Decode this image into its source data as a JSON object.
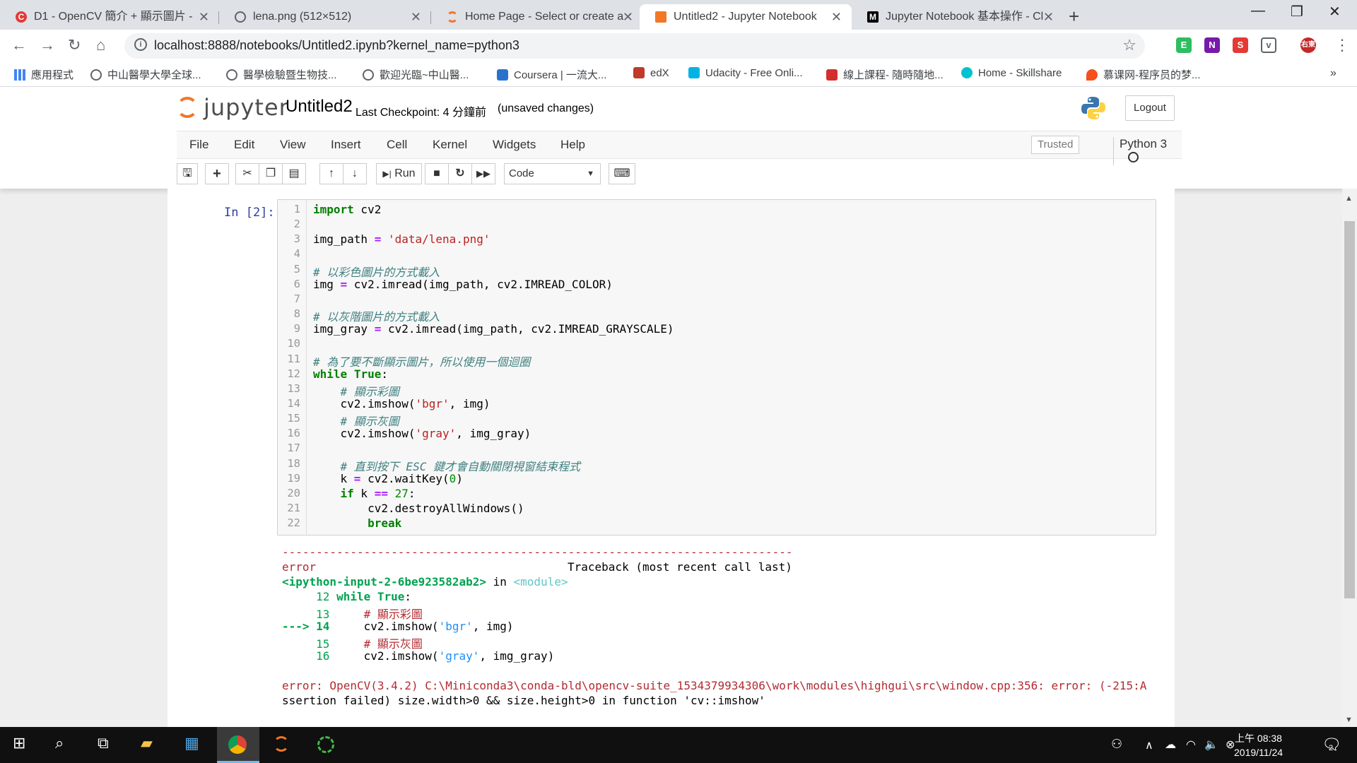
{
  "browser": {
    "tabs": [
      {
        "title": "D1 - OpenCV 簡介 + 顯示圖片 - ",
        "favicon": "red-c-icon",
        "active": false
      },
      {
        "title": "lena.png (512×512)",
        "favicon": "globe-icon",
        "active": false
      },
      {
        "title": "Home Page - Select or create a",
        "favicon": "jupyter-icon",
        "active": false
      },
      {
        "title": "Untitled2 - Jupyter Notebook",
        "favicon": "notebook-icon",
        "active": true
      },
      {
        "title": "Jupyter Notebook 基本操作 - Cl",
        "favicon": "medium-icon",
        "active": false
      }
    ],
    "url": "localhost:8888/notebooks/Untitled2.ipynb?kernel_name=python3",
    "profile": "右東",
    "bookmarks": [
      "應用程式",
      "中山醫學大學全球...",
      "醫學檢驗暨生物技...",
      "歡迎光臨~中山醫...",
      "Coursera | 一流大...",
      "edX",
      "Udacity - Free Onli...",
      "線上課程- 隨時隨地...",
      "Home - Skillshare",
      "慕课网-程序员的梦..."
    ]
  },
  "jupyter": {
    "logo_text": "jupyter",
    "notebook_name": "Untitled2",
    "checkpoint": "Last Checkpoint: 4 分鐘前",
    "unsaved": "(unsaved changes)",
    "logout": "Logout",
    "menu": [
      "File",
      "Edit",
      "View",
      "Insert",
      "Cell",
      "Kernel",
      "Widgets",
      "Help"
    ],
    "trusted": "Trusted",
    "kernel": "Python 3",
    "run_label": "Run",
    "cell_type": "Code"
  },
  "cell": {
    "prompt": "In [2]:",
    "line_numbers": [
      "1",
      "2",
      "3",
      "4",
      "5",
      "6",
      "7",
      "8",
      "9",
      "10",
      "11",
      "12",
      "13",
      "14",
      "15",
      "16",
      "17",
      "18",
      "19",
      "20",
      "21",
      "22"
    ],
    "code": [
      "import cv2",
      "",
      "img_path = 'data/lena.png'",
      "",
      "# 以彩色圖片的方式載入",
      "img = cv2.imread(img_path, cv2.IMREAD_COLOR)",
      "",
      "# 以灰階圖片的方式載入",
      "img_gray = cv2.imread(img_path, cv2.IMREAD_GRAYSCALE)",
      "",
      "# 為了要不斷顯示圖片，所以使用一個迴圈",
      "while True:",
      "    # 顯示彩圖",
      "    cv2.imshow('bgr', img)",
      "    # 顯示灰圖",
      "    cv2.imshow('gray', img_gray)",
      "",
      "    # 直到按下 ESC 鍵才會自動關閉視窗結束程式",
      "    k = cv2.waitKey(0)",
      "    if k == 27:",
      "        cv2.destroyAllWindows()",
      "        break"
    ]
  },
  "output": {
    "dashes": "---------------------------------------------------------------------------",
    "error_name": "error",
    "traceback_label": "Traceback (most recent call last)",
    "input_ref": "<ipython-input-2-6be923582ab2>",
    "in_word": " in ",
    "module": "<module>",
    "tb_lines": [
      {
        "marker": "     ",
        "num": "12",
        "code": " while True:"
      },
      {
        "marker": "     ",
        "num": "13",
        "code": "     # 顯示彩圖"
      },
      {
        "marker": "---> ",
        "num": "14",
        "code": "     cv2.imshow('bgr', img)"
      },
      {
        "marker": "     ",
        "num": "15",
        "code": "     # 顯示灰圖"
      },
      {
        "marker": "     ",
        "num": "16",
        "code": "     cv2.imshow('gray', img_gray)"
      }
    ],
    "error_line1": "error: OpenCV(3.4.2) C:\\Miniconda3\\conda-bld\\opencv-suite_1534379934306\\work\\modules\\highgui\\src\\window.cpp:356: error: (-215:A",
    "error_line2": "ssertion failed) size.width>0 && size.height>0 in function 'cv::imshow'"
  },
  "taskbar": {
    "time": "上午 08:38",
    "date": "2019/11/24",
    "notifications": "2"
  }
}
